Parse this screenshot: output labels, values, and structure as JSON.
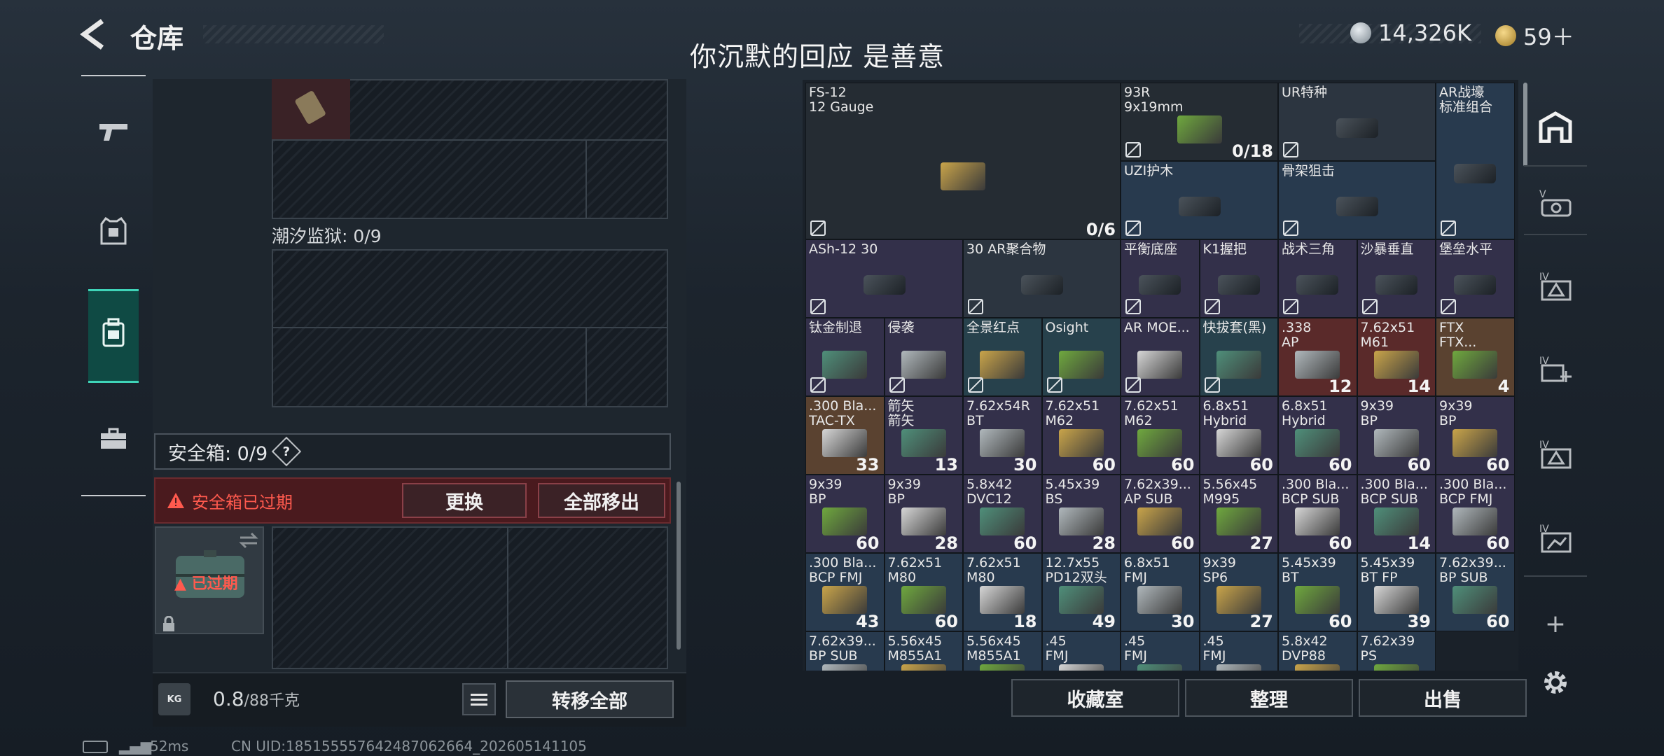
{
  "header": {
    "title": "仓库",
    "quote": "你沉默的回应  是善意",
    "currency_silver": "14,326K",
    "currency_gold": "59＋"
  },
  "left_panel": {
    "tide_prison_label": "潮汐监狱: 0/9",
    "safe_box_label": "安全箱: 0/9",
    "help": "?",
    "expired_warning": "安全箱已过期",
    "replace_label": "更换",
    "move_all_out_label": "全部移出",
    "case_expired": "已过期",
    "weight_current": "0.8",
    "weight_max": "/88千克",
    "transfer_all_label": "转移全部",
    "kg_icon": "KG"
  },
  "grid_items": [
    {
      "name": "FS-12",
      "sub": "12 Gauge",
      "count": "0/6",
      "color": "c-dark"
    },
    {
      "name": "93R",
      "sub": "9x19mm",
      "count": "0/18",
      "color": "c-dark"
    },
    {
      "name": "UR特种",
      "sub": "",
      "count": "",
      "color": "c-grey"
    },
    {
      "name": "AR战壕",
      "sub": "标准组合",
      "count": "",
      "color": "c-blue"
    },
    {
      "name": "UZI护木",
      "sub": "",
      "count": "",
      "color": "c-blue"
    },
    {
      "name": "骨架狙击",
      "sub": "",
      "count": "",
      "color": "c-blue"
    },
    {
      "name": "ASh-12 30",
      "sub": "",
      "count": "",
      "color": "c-purple"
    },
    {
      "name": "30 AR聚合物",
      "sub": "",
      "count": "",
      "color": "c-grey"
    },
    {
      "name": "平衡底座",
      "sub": "",
      "count": "",
      "color": "c-purple"
    },
    {
      "name": "K1握把",
      "sub": "",
      "count": "",
      "color": "c-purple"
    },
    {
      "name": "战术三角",
      "sub": "",
      "count": "",
      "color": "c-purple"
    },
    {
      "name": "沙暴垂直",
      "sub": "",
      "count": "",
      "color": "c-purple"
    },
    {
      "name": "堡垒水平",
      "sub": "",
      "count": "",
      "color": "c-purple"
    },
    {
      "name": "钛金制退",
      "sub": "",
      "count": "",
      "color": "c-purple"
    },
    {
      "name": "侵袭",
      "sub": "",
      "count": "",
      "color": "c-purple"
    },
    {
      "name": "全景红点",
      "sub": "",
      "count": "",
      "color": "c-teal"
    },
    {
      "name": "Osight",
      "sub": "",
      "count": "",
      "color": "c-teal"
    },
    {
      "name": "AR MOE...",
      "sub": "",
      "count": "",
      "color": "c-purple"
    },
    {
      "name": "快拔套(黑)",
      "sub": "",
      "count": "",
      "color": "c-teal"
    },
    {
      "name": ".338",
      "sub": "AP",
      "count": "12",
      "color": "c-red"
    },
    {
      "name": "7.62x51",
      "sub": "M61",
      "count": "14",
      "color": "c-red"
    },
    {
      "name": "FTX",
      "sub": "FTX...",
      "count": "4",
      "color": "c-orange"
    },
    {
      "name": ".300 Bla...",
      "sub": "TAC-TX",
      "count": "33",
      "color": "c-orange"
    },
    {
      "name": "箭矢",
      "sub": "箭矢",
      "count": "13",
      "color": "c-purple"
    },
    {
      "name": "7.62x54R",
      "sub": "BT",
      "count": "30",
      "color": "c-purple"
    },
    {
      "name": "7.62x51",
      "sub": "M62",
      "count": "60",
      "color": "c-purple"
    },
    {
      "name": "7.62x51",
      "sub": "M62",
      "count": "60",
      "color": "c-purple"
    },
    {
      "name": "6.8x51",
      "sub": "Hybrid",
      "count": "60",
      "color": "c-purple"
    },
    {
      "name": "6.8x51",
      "sub": "Hybrid",
      "count": "60",
      "color": "c-purple"
    },
    {
      "name": "9x39",
      "sub": "BP",
      "count": "60",
      "color": "c-purple"
    },
    {
      "name": "9x39",
      "sub": "BP",
      "count": "60",
      "color": "c-purple"
    },
    {
      "name": "9x39",
      "sub": "BP",
      "count": "60",
      "color": "c-purple"
    },
    {
      "name": "9x39",
      "sub": "BP",
      "count": "28",
      "color": "c-purple"
    },
    {
      "name": "5.8x42",
      "sub": "DVC12",
      "count": "60",
      "color": "c-purple"
    },
    {
      "name": "5.45x39",
      "sub": "BS",
      "count": "28",
      "color": "c-purple"
    },
    {
      "name": "7.62x39...",
      "sub": "AP SUB",
      "count": "60",
      "color": "c-purple"
    },
    {
      "name": "5.56x45",
      "sub": "M995",
      "count": "27",
      "color": "c-purple"
    },
    {
      "name": ".300 Bla...",
      "sub": "BCP SUB",
      "count": "60",
      "color": "c-purple"
    },
    {
      "name": ".300 Bla...",
      "sub": "BCP SUB",
      "count": "14",
      "color": "c-purple"
    },
    {
      "name": ".300 Bla...",
      "sub": "BCP FMJ",
      "count": "60",
      "color": "c-purple"
    },
    {
      "name": ".300 Bla...",
      "sub": "BCP FMJ",
      "count": "43",
      "color": "c-blue"
    },
    {
      "name": "7.62x51",
      "sub": "M80",
      "count": "60",
      "color": "c-blue"
    },
    {
      "name": "7.62x51",
      "sub": "M80",
      "count": "18",
      "color": "c-blue"
    },
    {
      "name": "12.7x55",
      "sub": "PD12双头",
      "count": "49",
      "color": "c-blue"
    },
    {
      "name": "6.8x51",
      "sub": "FMJ",
      "count": "30",
      "color": "c-blue"
    },
    {
      "name": "9x39",
      "sub": "SP6",
      "count": "27",
      "color": "c-blue"
    },
    {
      "name": "5.45x39",
      "sub": "BT",
      "count": "60",
      "color": "c-blue"
    },
    {
      "name": "5.45x39",
      "sub": "BT FP",
      "count": "39",
      "color": "c-blue"
    },
    {
      "name": "7.62x39...",
      "sub": "BP SUB",
      "count": "60",
      "color": "c-blue"
    },
    {
      "name": "7.62x39...",
      "sub": "BP SUB",
      "count": "",
      "color": "c-blue"
    },
    {
      "name": "5.56x45",
      "sub": "M855A1",
      "count": "",
      "color": "c-blue"
    },
    {
      "name": "5.56x45",
      "sub": "M855A1",
      "count": "",
      "color": "c-blue"
    },
    {
      "name": ".45",
      "sub": "FMJ",
      "count": "",
      "color": "c-blue"
    },
    {
      "name": ".45",
      "sub": "FMJ",
      "count": "",
      "color": "c-blue"
    },
    {
      "name": ".45",
      "sub": "FMJ",
      "count": "",
      "color": "c-blue"
    },
    {
      "name": "5.8x42",
      "sub": "DVP88",
      "count": "",
      "color": "c-blue"
    },
    {
      "name": "7.62x39",
      "sub": "PS",
      "count": "",
      "color": "c-blue"
    }
  ],
  "bottom_buttons": {
    "collection": "收藏室",
    "sort": "整理",
    "sell": "出售"
  },
  "status_bar": {
    "ping": "52ms",
    "uid": "CN UID:185155557642487062664_202605141105"
  },
  "colors": {
    "accent": "#3fd4b8",
    "warning": "#ff5a4e"
  }
}
